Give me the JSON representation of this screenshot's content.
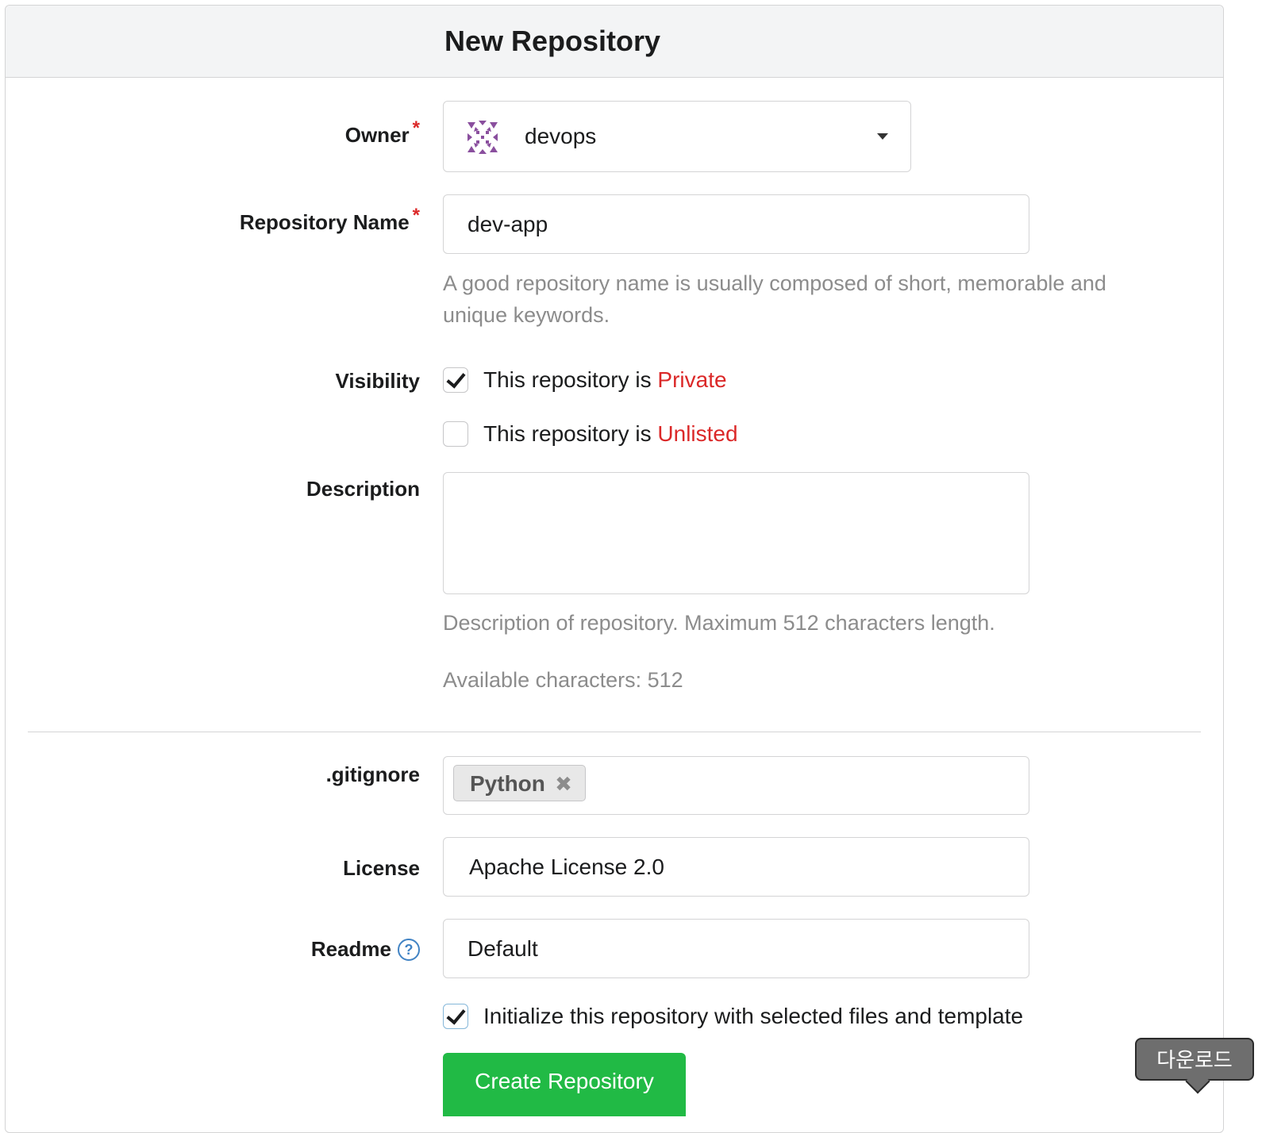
{
  "header": {
    "title": "New Repository"
  },
  "owner": {
    "label": "Owner",
    "required_mark": "*",
    "value": "devops",
    "avatar_icon": "identicon-icon",
    "dropdown_icon": "caret-down-icon"
  },
  "repo_name": {
    "label": "Repository Name",
    "required_mark": "*",
    "value": "dev-app",
    "help": "A good repository name is usually composed of short, memorable and unique keywords."
  },
  "visibility": {
    "label": "Visibility",
    "private": {
      "checked": true,
      "prefix": "This repository is ",
      "word": "Private"
    },
    "unlisted": {
      "checked": false,
      "prefix": "This repository is ",
      "word": "Unlisted"
    }
  },
  "description": {
    "label": "Description",
    "value": "",
    "help": "Description of repository. Maximum 512 characters length.",
    "available": "Available characters: 512"
  },
  "gitignore": {
    "label": ".gitignore",
    "tags": [
      "Python"
    ],
    "remove_icon": "close-icon"
  },
  "license": {
    "label": "License",
    "value": "Apache License 2.0"
  },
  "readme": {
    "label": "Readme",
    "help_icon": "question-circle-icon",
    "value": "Default"
  },
  "init": {
    "checked": true,
    "label": "Initialize this repository with selected files and template"
  },
  "submit": {
    "label": "Create Repository"
  },
  "tooltip": {
    "text": "다운로드"
  },
  "colors": {
    "accent_red": "#db2828",
    "button_green": "#21ba45",
    "help_gray": "#8c8c8c",
    "link_blue": "#4183c4"
  }
}
